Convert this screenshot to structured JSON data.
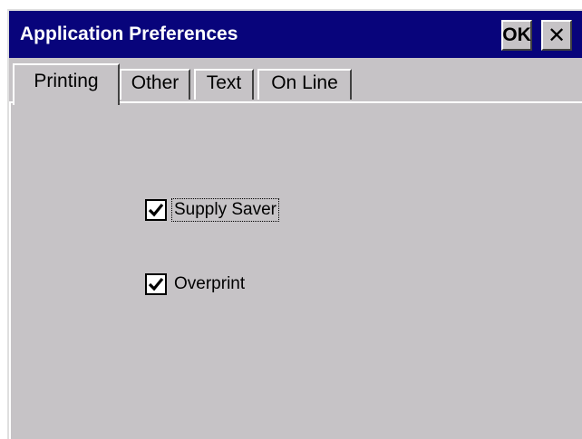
{
  "window": {
    "title": "Application Preferences",
    "ok_label": "OK",
    "close_icon": "close-icon",
    "close_glyph": "✕"
  },
  "tabs": [
    {
      "label": "Printing",
      "active": true
    },
    {
      "label": "Other",
      "active": false
    },
    {
      "label": "Text",
      "active": false
    },
    {
      "label": "On Line",
      "active": false
    }
  ],
  "printing": {
    "options": [
      {
        "label": "Supply Saver",
        "checked": true,
        "focused": true
      },
      {
        "label": "Overprint",
        "checked": true,
        "focused": false
      }
    ]
  },
  "colors": {
    "titlebar": "#08047b",
    "face": "#c6c3c6"
  }
}
